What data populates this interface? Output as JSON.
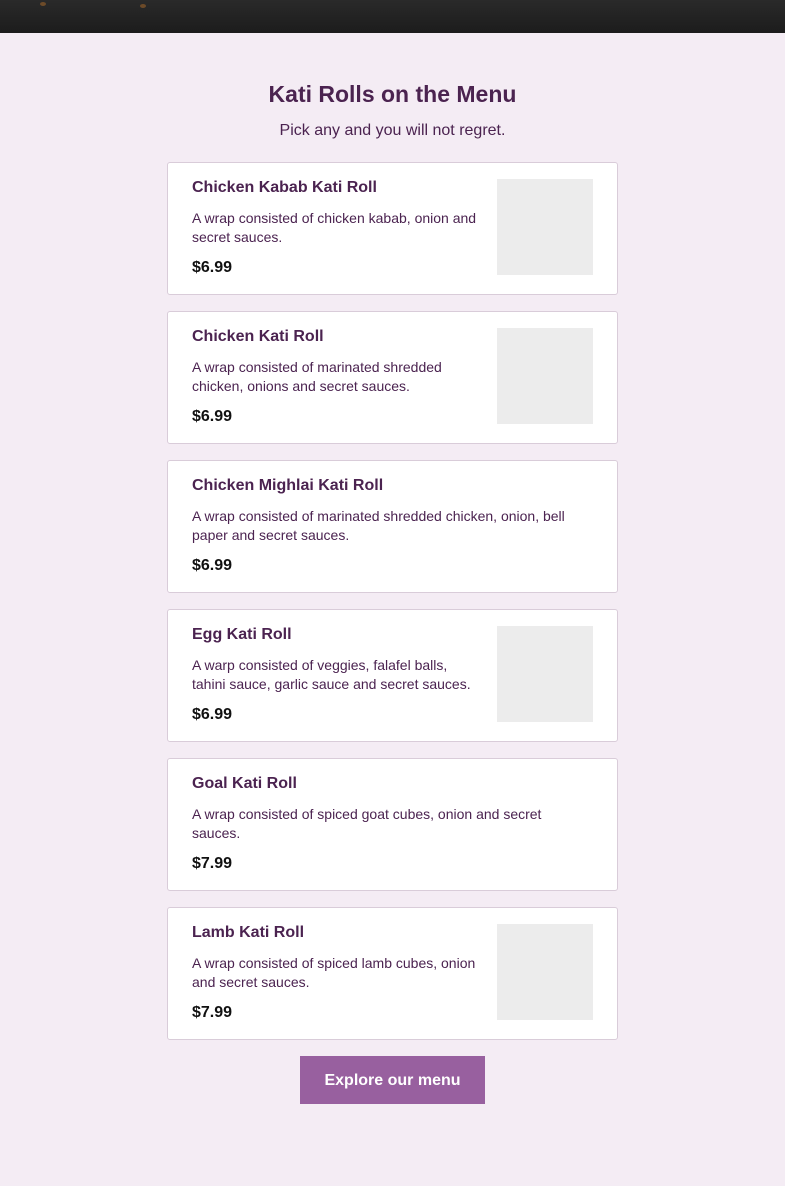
{
  "section": {
    "title": "Kati Rolls on the Menu",
    "subtitle": "Pick any and you will not regret."
  },
  "items": [
    {
      "name": "Chicken Kabab Kati Roll",
      "description": "A wrap consisted of chicken kabab, onion and secret sauces.",
      "price": "$6.99",
      "has_image": true
    },
    {
      "name": "Chicken Kati Roll",
      "description": "A wrap consisted of marinated shredded chicken, onions and secret sauces.",
      "price": "$6.99",
      "has_image": true
    },
    {
      "name": "Chicken Mighlai Kati Roll",
      "description": "A wrap consisted of marinated shredded chicken, onion, bell paper and secret sauces.",
      "price": "$6.99",
      "has_image": false
    },
    {
      "name": "Egg Kati Roll",
      "description": "A warp consisted of veggies, falafel balls, tahini sauce, garlic sauce and secret sauces.",
      "price": "$6.99",
      "has_image": true
    },
    {
      "name": "Goal Kati Roll",
      "description": "A wrap consisted of spiced goat cubes, onion and secret sauces.",
      "price": "$7.99",
      "has_image": false
    },
    {
      "name": "Lamb Kati Roll",
      "description": "A wrap consisted of spiced lamb cubes, onion and secret sauces.",
      "price": "$7.99",
      "has_image": true
    }
  ],
  "cta": {
    "label": "Explore our menu"
  },
  "colors": {
    "page_background": "#f4ecf4",
    "accent": "#98609f",
    "heading": "#4b2350",
    "image_placeholder": "#ececec"
  }
}
